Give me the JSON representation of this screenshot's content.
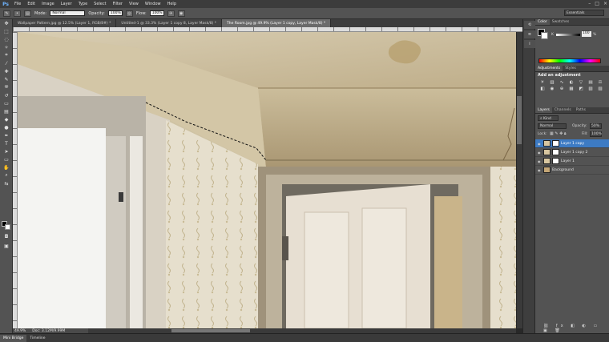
{
  "menubar": {
    "logo": "Ps",
    "items": [
      "File",
      "Edit",
      "Image",
      "Layer",
      "Type",
      "Select",
      "Filter",
      "View",
      "Window",
      "Help"
    ],
    "window_controls": [
      "–",
      "□",
      "×"
    ]
  },
  "options_bar": {
    "mode_label": "Mode:",
    "mode_value": "Normal",
    "opacity_label": "Opacity:",
    "opacity_value": "100%",
    "flow_label": "Flow:",
    "flow_value": "100%",
    "workspace": "Essentials"
  },
  "tabs": [
    {
      "label": "Wallpaper Pattern.jpg @ 12.5% (Layer 1, RGB/8#) *",
      "active": false
    },
    {
      "label": "Untitled-1 @ 33.3% (Layer 1 copy 8, Layer Mask/8) *",
      "active": false
    },
    {
      "label": "The Room.jpg @ 49.9% (Layer 1 copy, Layer Mask/8) *",
      "active": true
    }
  ],
  "status": {
    "zoom": "49.9%",
    "doc": "Doc: 3.12M/9.99M"
  },
  "bottom_tabs": [
    "Mini Bridge",
    "Timeline"
  ],
  "panels": {
    "color_tabs": [
      "Color",
      "Swatches"
    ],
    "color_k_label": "K",
    "color_k_value": "100",
    "color_k_unit": "%",
    "adjustments_tabs": [
      "Adjustments",
      "Styles"
    ],
    "adjustments_title": "Add an adjustment",
    "layers_tabs": [
      "Layers",
      "Channels",
      "Paths"
    ],
    "kind_label": "Kind",
    "blend_mode": "Normal",
    "opacity_label": "Opacity:",
    "opacity_value": "50%",
    "lock_label": "Lock:",
    "fill_label": "Fill:",
    "fill_value": "100%",
    "layers": [
      {
        "name": "Layer 1 copy",
        "selected": true
      },
      {
        "name": "Layer 1 copy 2",
        "selected": false
      },
      {
        "name": "Layer 1",
        "selected": false
      },
      {
        "name": "Background",
        "selected": false
      }
    ]
  },
  "colors": {
    "chrome_dark": "#282828",
    "panel": "#535353",
    "selection": "#3d7bc4"
  }
}
